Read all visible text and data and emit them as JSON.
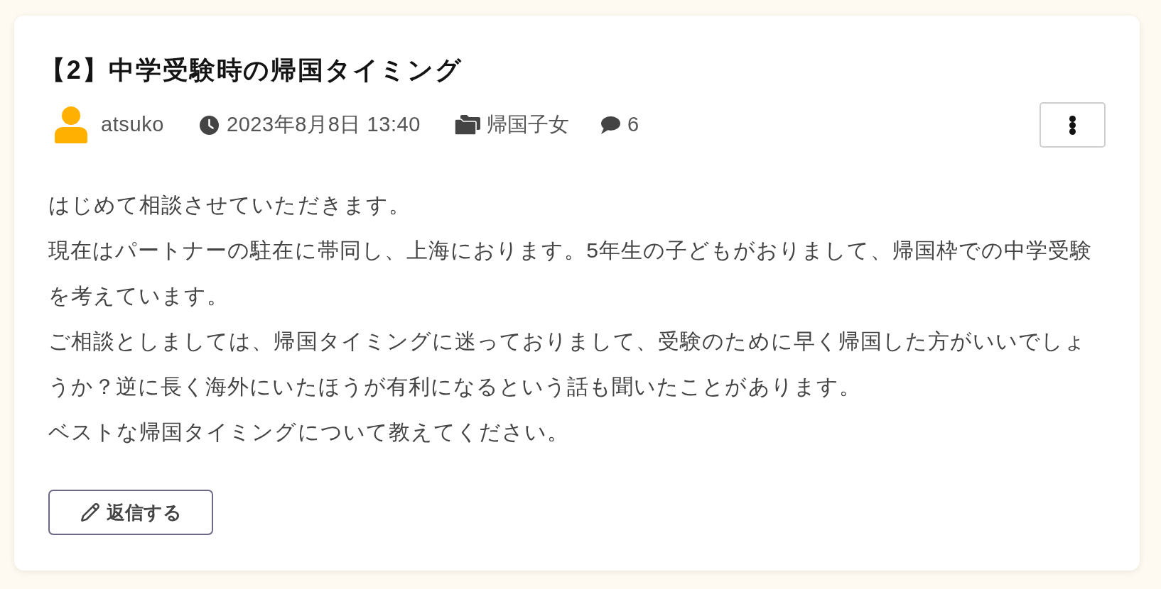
{
  "post": {
    "title": "【2】中学受験時の帰国タイミング",
    "meta": {
      "author": "atsuko",
      "date": "2023年8月8日 13:40",
      "category": "帰国子女",
      "comments": "6"
    },
    "body": [
      "はじめて相談させていただきます。",
      "現在はパートナーの駐在に帯同し、上海におります。5年生の子どもがおりまして、帰国枠での中学受験を考えています。",
      "ご相談としましては、帰国タイミングに迷っておりまして、受験のために早く帰国した方がいいでしょうか？逆に長く海外にいたほうが有利になるという話も聞いたことがあります。",
      "ベストな帰国タイミングについて教えてください。"
    ]
  },
  "reply_button": {
    "label": "返信する"
  }
}
